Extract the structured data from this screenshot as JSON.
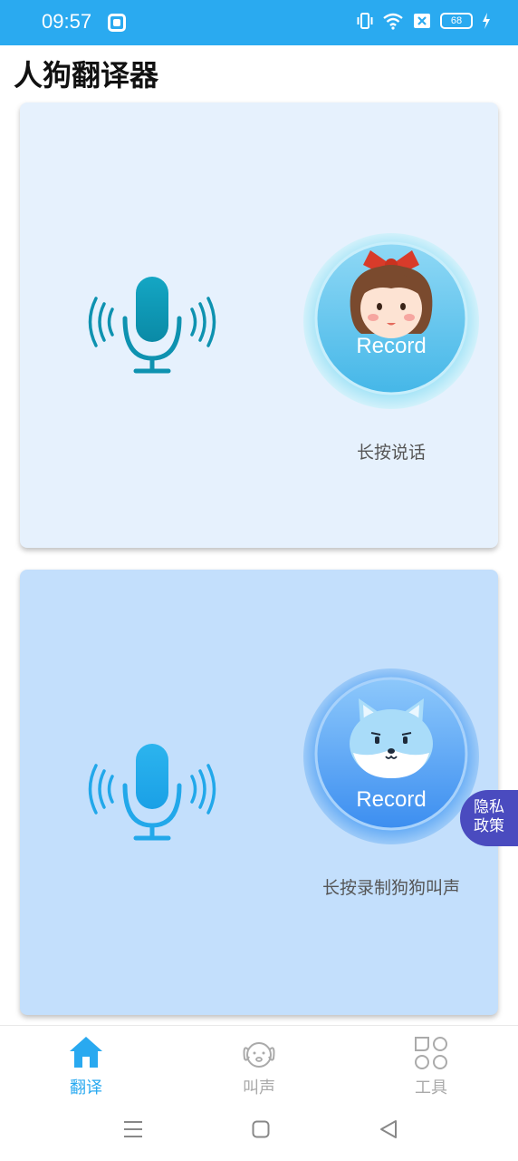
{
  "status_bar": {
    "time": "09:57",
    "battery": "68"
  },
  "page_title": "人狗翻译器",
  "cards": [
    {
      "record_label": "Record",
      "caption": "长按说话"
    },
    {
      "record_label": "Record",
      "caption": "长按录制狗狗叫声"
    }
  ],
  "privacy_button": {
    "line1": "隐私",
    "line2": "政策"
  },
  "tabs": [
    {
      "label": "翻译",
      "icon": "home-icon",
      "active": true
    },
    {
      "label": "叫声",
      "icon": "dog-face-icon",
      "active": false
    },
    {
      "label": "工具",
      "icon": "tools-grid-icon",
      "active": false
    }
  ],
  "colors": {
    "status_bar": "#2aaaf0",
    "card1_bg": "#e6f1fd",
    "card2_bg": "#c3dffc",
    "tab_active": "#29a9f0",
    "tab_inactive": "#aaaaaa",
    "privacy_bg": "#4a4bbf"
  }
}
